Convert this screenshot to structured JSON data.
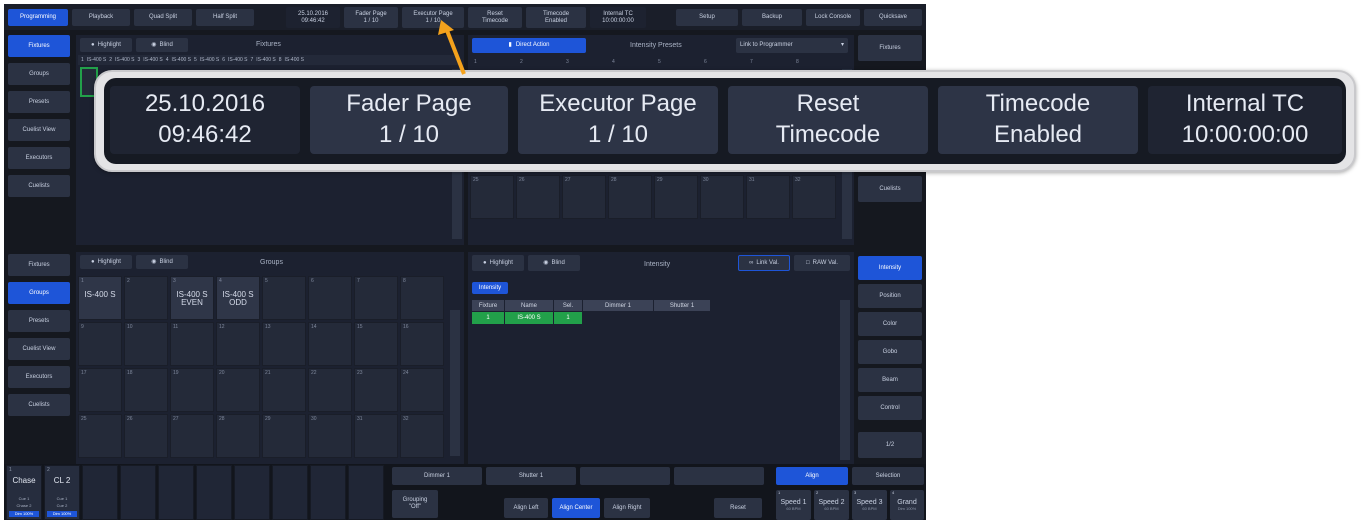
{
  "topbar": [
    {
      "label": "Programming",
      "active": true
    },
    {
      "label": "Playback"
    },
    {
      "label": "Quad Split"
    },
    {
      "label": "Half Split"
    },
    {
      "label": "25.10.2016\n09:46:42"
    },
    {
      "label": "Fader Page\n1 / 10"
    },
    {
      "label": "Executor Page\n1 / 10"
    },
    {
      "label": "Reset\nTimecode"
    },
    {
      "label": "Timecode\nEnabled"
    },
    {
      "label": "Internal TC\n10:00:00:00"
    },
    {
      "label": "Setup"
    },
    {
      "label": "Backup"
    },
    {
      "label": "Lock Console"
    },
    {
      "label": "Quicksave"
    }
  ],
  "left_top_nav": [
    "Fixtures",
    "Groups",
    "Presets",
    "Cuelist View",
    "Executors",
    "Cuelists"
  ],
  "left_bottom_nav": [
    "Fixtures",
    "Groups",
    "Presets",
    "Cuelist View",
    "Executors",
    "Cuelists"
  ],
  "fixtures_panel": {
    "highlight": "Highlight",
    "blind": "Blind",
    "title": "Fixtures",
    "strip": [
      "1",
      "IS-400 S",
      "2",
      "IS-400 S",
      "3",
      "IS-400 S",
      "4",
      "IS-400 S",
      "5",
      "IS-400 S",
      "6",
      "IS-400 S",
      "7",
      "IS-400 S",
      "8",
      "IS-400 S"
    ]
  },
  "intensity_presets_panel": {
    "direct_action": "Direct Action",
    "title": "Intensity Presets",
    "link": "Link to Programmer",
    "numbers": [
      "1",
      "2",
      "3",
      "4",
      "5",
      "6",
      "7",
      "8"
    ],
    "row_numbers": [
      "25",
      "26",
      "27",
      "28",
      "29",
      "30",
      "31",
      "32"
    ]
  },
  "right_top_nav": [
    "Fixtures",
    "Cuelists"
  ],
  "groups_panel": {
    "highlight": "Highlight",
    "blind": "Blind",
    "title": "Groups",
    "cells": [
      {
        "n": "1",
        "t": "IS-400 S"
      },
      {
        "n": "2",
        "t": ""
      },
      {
        "n": "3",
        "t": "IS-400 S\nEVEN"
      },
      {
        "n": "4",
        "t": "IS-400 S\nODD"
      },
      {
        "n": "5",
        "t": ""
      },
      {
        "n": "6",
        "t": ""
      },
      {
        "n": "7",
        "t": ""
      },
      {
        "n": "8",
        "t": ""
      },
      {
        "n": "9",
        "t": ""
      },
      {
        "n": "10",
        "t": ""
      },
      {
        "n": "11",
        "t": ""
      },
      {
        "n": "12",
        "t": ""
      },
      {
        "n": "13",
        "t": ""
      },
      {
        "n": "14",
        "t": ""
      },
      {
        "n": "15",
        "t": ""
      },
      {
        "n": "16",
        "t": ""
      },
      {
        "n": "17",
        "t": ""
      },
      {
        "n": "18",
        "t": ""
      },
      {
        "n": "19",
        "t": ""
      },
      {
        "n": "20",
        "t": ""
      },
      {
        "n": "21",
        "t": ""
      },
      {
        "n": "22",
        "t": ""
      },
      {
        "n": "23",
        "t": ""
      },
      {
        "n": "24",
        "t": ""
      },
      {
        "n": "25",
        "t": ""
      },
      {
        "n": "26",
        "t": ""
      },
      {
        "n": "27",
        "t": ""
      },
      {
        "n": "28",
        "t": ""
      },
      {
        "n": "29",
        "t": ""
      },
      {
        "n": "30",
        "t": ""
      },
      {
        "n": "31",
        "t": ""
      },
      {
        "n": "32",
        "t": ""
      }
    ]
  },
  "intensity_panel": {
    "highlight": "Highlight",
    "blind": "Blind",
    "title": "Intensity",
    "link_val": "Link Val.",
    "raw_val": "RAW Val.",
    "tab": "Intensity",
    "columns": [
      "Fixture",
      "Name",
      "Sel.",
      "Dimmer 1",
      "Shutter 1"
    ],
    "row": [
      "1",
      "IS-400 S",
      "1",
      "",
      ""
    ]
  },
  "right_bottom_nav": [
    "Intensity",
    "Position",
    "Color",
    "Gobo",
    "Beam",
    "Control",
    "1/2"
  ],
  "bottom": {
    "exec1": {
      "num": "1",
      "big": "Chase",
      "small1": "Cue 1",
      "small2": "Chase 2",
      "foot": "Dim 100%"
    },
    "exec2": {
      "num": "2",
      "big": "CL 2",
      "small1": "Cue 1",
      "small2": "Cue 2",
      "foot": "Dim 100%"
    },
    "dimmer": "Dimmer 1",
    "shutter": "Shutter 1",
    "grouping": "Grouping\n\"Off\"",
    "align_left": "Align Left",
    "align_center": "Align Center",
    "align_right": "Align Right",
    "reset": "Reset",
    "align": "Align",
    "selection": "Selection",
    "speeds": [
      {
        "num": "1",
        "label": "Speed 1",
        "foot": "60 BPM"
      },
      {
        "num": "2",
        "label": "Speed 2",
        "foot": "60 BPM"
      },
      {
        "num": "3",
        "label": "Speed 3",
        "foot": "60 BPM"
      },
      {
        "num": "4",
        "label": "Grand",
        "foot": "Dim 100%"
      }
    ]
  },
  "zoom_callout": [
    {
      "l1": "25.10.2016",
      "l2": "09:46:42"
    },
    {
      "l1": "Fader Page",
      "l2": "1 / 10"
    },
    {
      "l1": "Executor Page",
      "l2": "1 / 10"
    },
    {
      "l1": "Reset",
      "l2": "Timecode"
    },
    {
      "l1": "Timecode",
      "l2": "Enabled"
    },
    {
      "l1": "Internal TC",
      "l2": "10:00:00:00"
    }
  ],
  "colors": {
    "accent": "#1e55d8",
    "bg": "#15181f",
    "panel": "#1c2130",
    "callout_arrow": "#f4a21c",
    "selected": "#22a04a"
  }
}
